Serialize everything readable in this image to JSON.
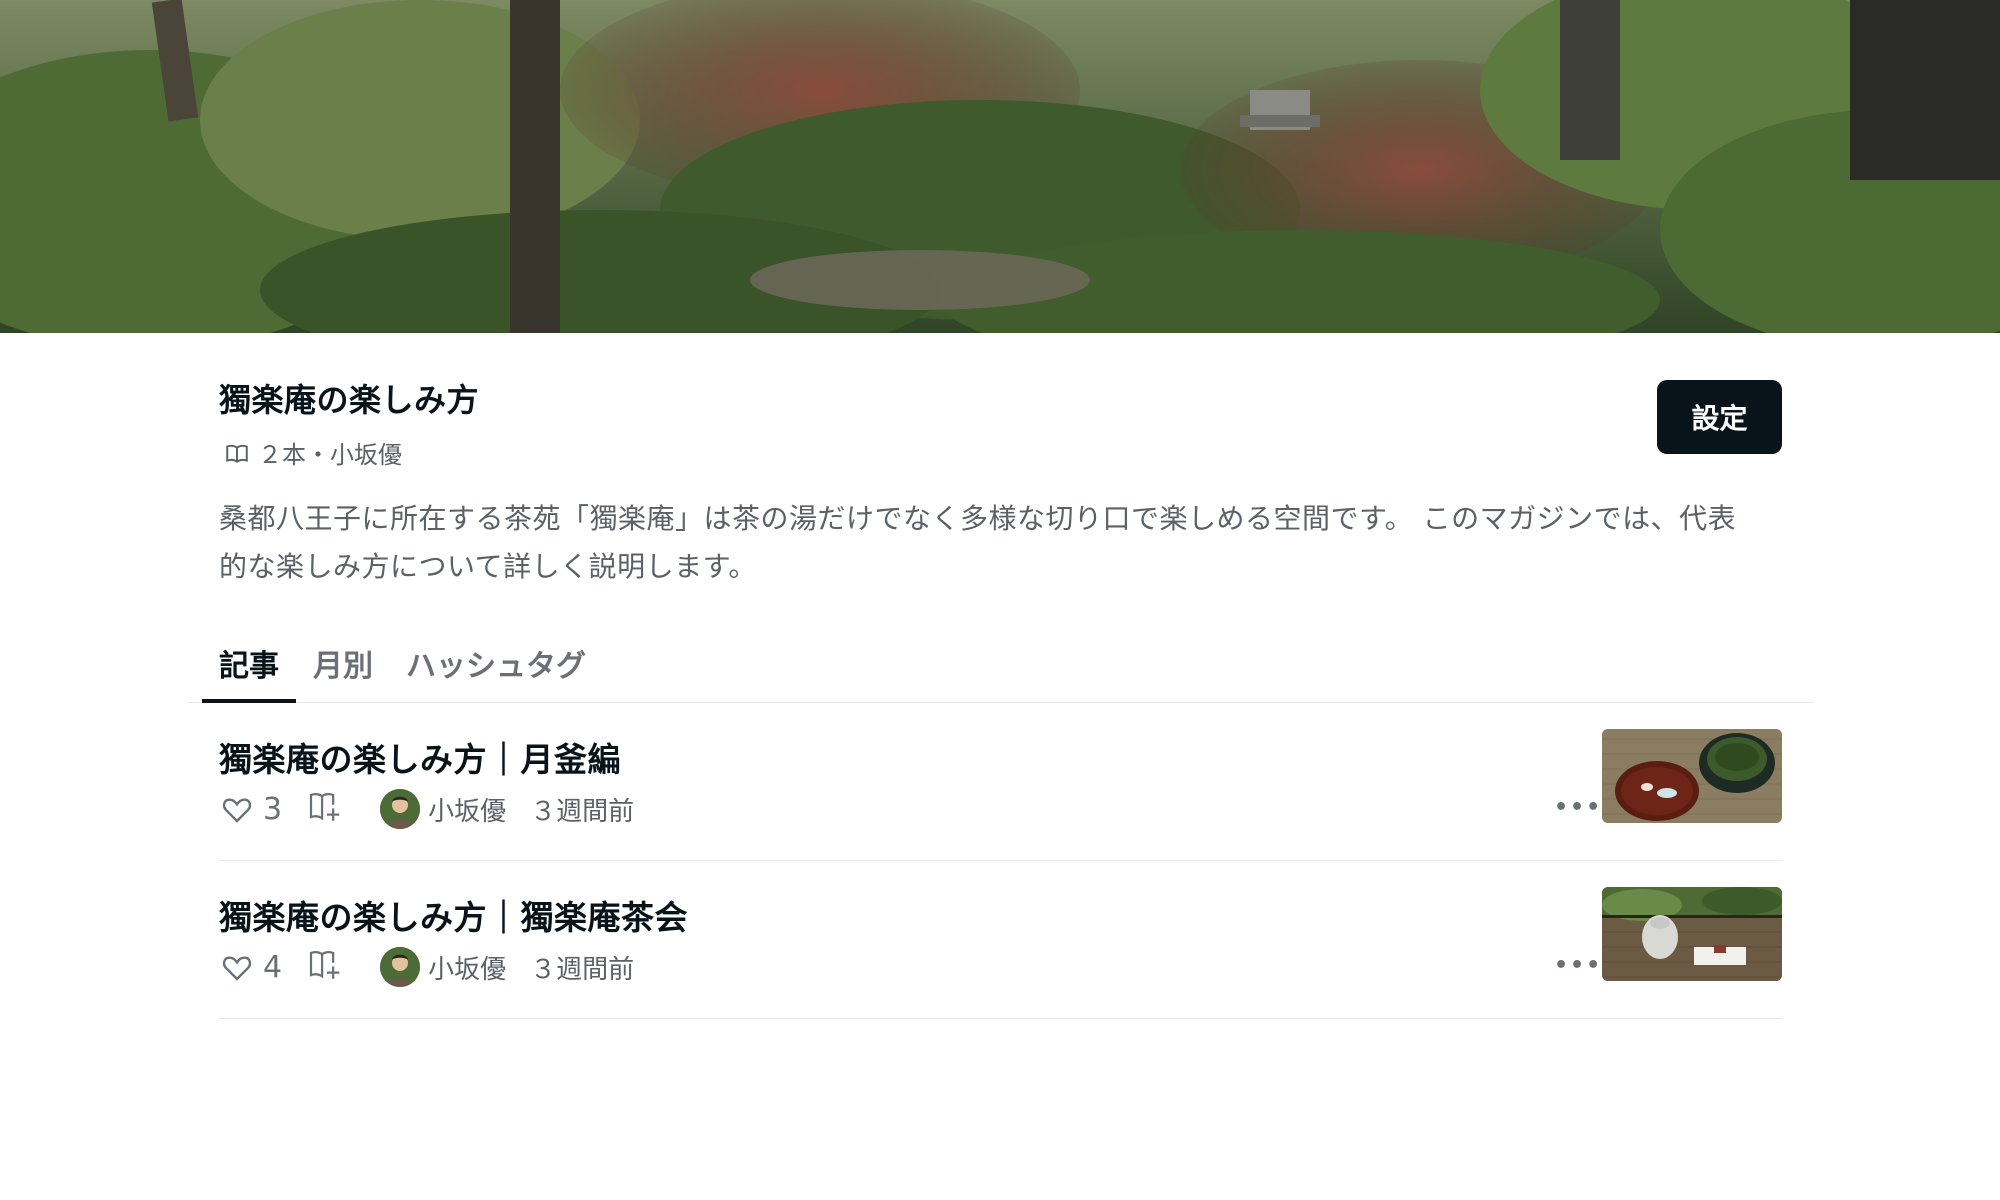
{
  "magazine": {
    "title": "獨楽庵の楽しみ方",
    "meta": "２本・小坂優",
    "settings_label": "設定",
    "description": "桑都八王子に所在する茶苑「獨楽庵」は茶の湯だけでなく多様な切り口で楽しめる空間です。 このマガジンでは、代表的な楽しみ方について詳しく説明します。"
  },
  "tabs": [
    {
      "label": "記事",
      "active": true
    },
    {
      "label": "月別",
      "active": false
    },
    {
      "label": "ハッシュタグ",
      "active": false
    }
  ],
  "articles": [
    {
      "title": "獨楽庵の楽しみ方｜月釜編",
      "likes": "3",
      "author": "小坂優",
      "when": "３週間前",
      "more": "•••"
    },
    {
      "title": "獨楽庵の楽しみ方｜獨楽庵茶会",
      "likes": "4",
      "author": "小坂優",
      "when": "３週間前",
      "more": "•••"
    }
  ],
  "icons": {
    "book": "book-icon",
    "heart": "heart-icon",
    "add_to_magazine": "add-to-magazine-icon",
    "more": "more-icon"
  },
  "colors": {
    "primary": "#08131a",
    "muted": "#5b6166",
    "divider": "#e6e8ea"
  }
}
